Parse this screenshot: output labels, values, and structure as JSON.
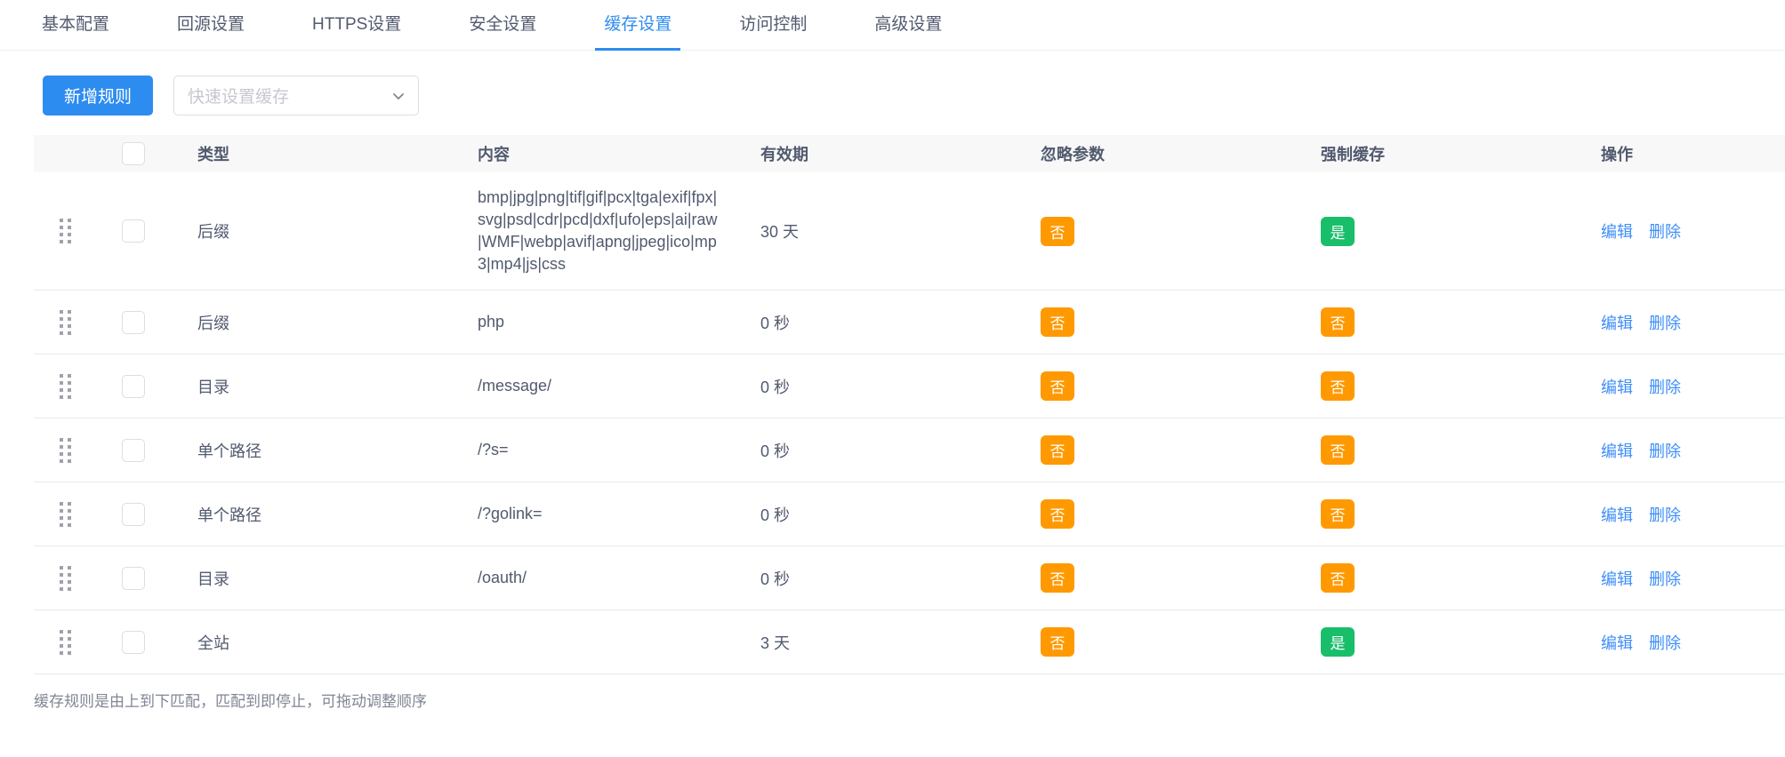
{
  "colors": {
    "primary": "#2d8cf0",
    "warning": "#ff9900",
    "success": "#19be6b"
  },
  "tabs": {
    "active_index": 4,
    "items": [
      {
        "label": "基本配置"
      },
      {
        "label": "回源设置"
      },
      {
        "label": "HTTPS设置"
      },
      {
        "label": "安全设置"
      },
      {
        "label": "缓存设置"
      },
      {
        "label": "访问控制"
      },
      {
        "label": "高级设置"
      }
    ]
  },
  "toolbar": {
    "add_rule_label": "新增规则",
    "quick_select_placeholder": "快速设置缓存",
    "chevron_icon": "chevron-down"
  },
  "table": {
    "headers": {
      "type": "类型",
      "content": "内容",
      "ttl": "有效期",
      "ignore_params": "忽略参数",
      "force_cache": "强制缓存",
      "actions": "操作"
    },
    "actions": {
      "edit": "编辑",
      "delete": "删除"
    },
    "rows": [
      {
        "type": "后缀",
        "content": "bmp|jpg|png|tif|gif|pcx|tga|exif|fpx|svg|psd|cdr|pcd|dxf|ufo|eps|ai|raw|WMF|webp|avif|apng|jpeg|ico|mp3|mp4|js|css",
        "ttl": "30 天",
        "ignore": {
          "label": "否",
          "state": "no"
        },
        "force": {
          "label": "是",
          "state": "yes"
        }
      },
      {
        "type": "后缀",
        "content": "php",
        "ttl": "0 秒",
        "ignore": {
          "label": "否",
          "state": "no"
        },
        "force": {
          "label": "否",
          "state": "no"
        }
      },
      {
        "type": "目录",
        "content": "/message/",
        "ttl": "0 秒",
        "ignore": {
          "label": "否",
          "state": "no"
        },
        "force": {
          "label": "否",
          "state": "no"
        }
      },
      {
        "type": "单个路径",
        "content": "/?s=",
        "ttl": "0 秒",
        "ignore": {
          "label": "否",
          "state": "no"
        },
        "force": {
          "label": "否",
          "state": "no"
        }
      },
      {
        "type": "单个路径",
        "content": "/?golink=",
        "ttl": "0 秒",
        "ignore": {
          "label": "否",
          "state": "no"
        },
        "force": {
          "label": "否",
          "state": "no"
        }
      },
      {
        "type": "目录",
        "content": "/oauth/",
        "ttl": "0 秒",
        "ignore": {
          "label": "否",
          "state": "no"
        },
        "force": {
          "label": "否",
          "state": "no"
        }
      },
      {
        "type": "全站",
        "content": "",
        "ttl": "3 天",
        "ignore": {
          "label": "否",
          "state": "no"
        },
        "force": {
          "label": "是",
          "state": "yes"
        }
      }
    ]
  },
  "footer": {
    "note": "缓存规则是由上到下匹配，匹配到即停止，可拖动调整顺序"
  }
}
